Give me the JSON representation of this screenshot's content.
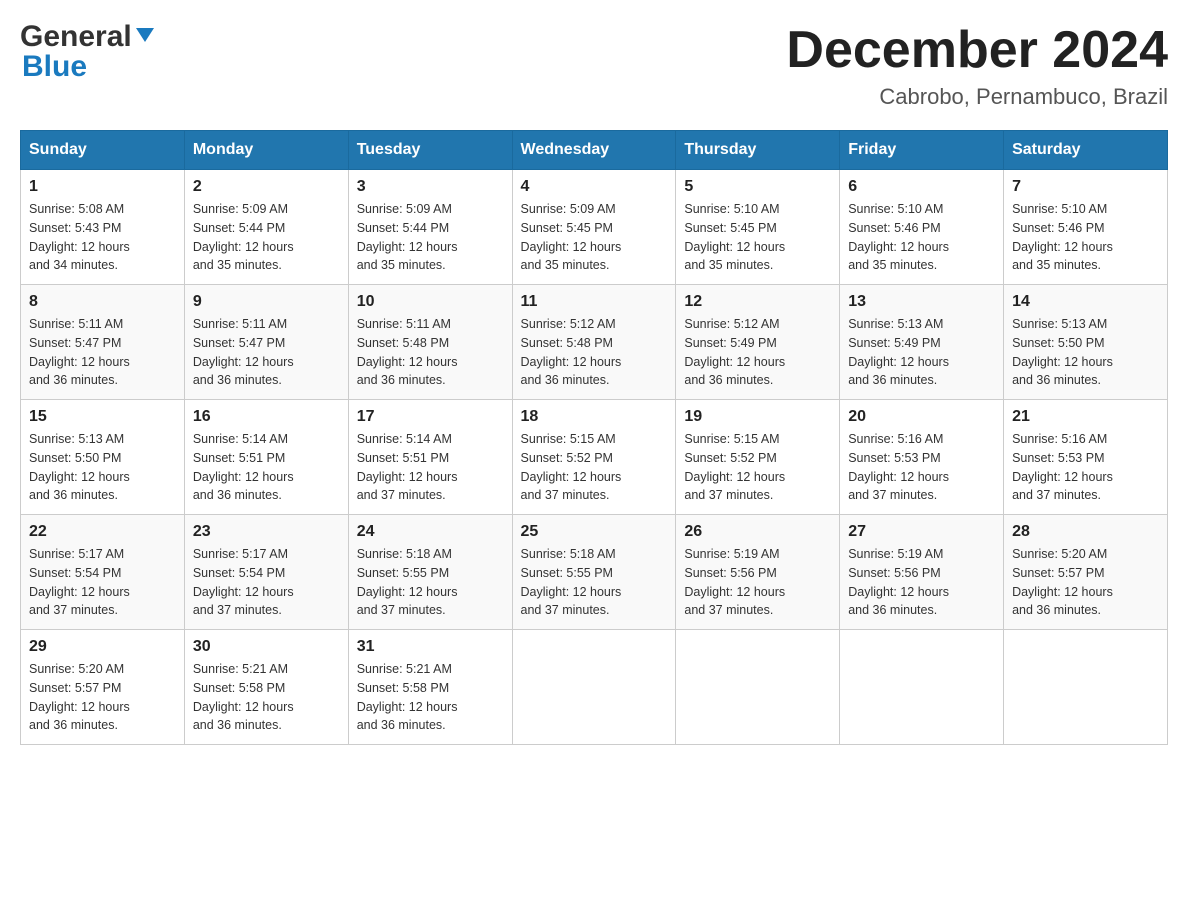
{
  "logo": {
    "general": "General",
    "blue": "Blue"
  },
  "header": {
    "month": "December 2024",
    "location": "Cabrobo, Pernambuco, Brazil"
  },
  "days_of_week": [
    "Sunday",
    "Monday",
    "Tuesday",
    "Wednesday",
    "Thursday",
    "Friday",
    "Saturday"
  ],
  "weeks": [
    [
      {
        "day": "1",
        "sunrise": "5:08 AM",
        "sunset": "5:43 PM",
        "daylight": "12 hours and 34 minutes."
      },
      {
        "day": "2",
        "sunrise": "5:09 AM",
        "sunset": "5:44 PM",
        "daylight": "12 hours and 35 minutes."
      },
      {
        "day": "3",
        "sunrise": "5:09 AM",
        "sunset": "5:44 PM",
        "daylight": "12 hours and 35 minutes."
      },
      {
        "day": "4",
        "sunrise": "5:09 AM",
        "sunset": "5:45 PM",
        "daylight": "12 hours and 35 minutes."
      },
      {
        "day": "5",
        "sunrise": "5:10 AM",
        "sunset": "5:45 PM",
        "daylight": "12 hours and 35 minutes."
      },
      {
        "day": "6",
        "sunrise": "5:10 AM",
        "sunset": "5:46 PM",
        "daylight": "12 hours and 35 minutes."
      },
      {
        "day": "7",
        "sunrise": "5:10 AM",
        "sunset": "5:46 PM",
        "daylight": "12 hours and 35 minutes."
      }
    ],
    [
      {
        "day": "8",
        "sunrise": "5:11 AM",
        "sunset": "5:47 PM",
        "daylight": "12 hours and 36 minutes."
      },
      {
        "day": "9",
        "sunrise": "5:11 AM",
        "sunset": "5:47 PM",
        "daylight": "12 hours and 36 minutes."
      },
      {
        "day": "10",
        "sunrise": "5:11 AM",
        "sunset": "5:48 PM",
        "daylight": "12 hours and 36 minutes."
      },
      {
        "day": "11",
        "sunrise": "5:12 AM",
        "sunset": "5:48 PM",
        "daylight": "12 hours and 36 minutes."
      },
      {
        "day": "12",
        "sunrise": "5:12 AM",
        "sunset": "5:49 PM",
        "daylight": "12 hours and 36 minutes."
      },
      {
        "day": "13",
        "sunrise": "5:13 AM",
        "sunset": "5:49 PM",
        "daylight": "12 hours and 36 minutes."
      },
      {
        "day": "14",
        "sunrise": "5:13 AM",
        "sunset": "5:50 PM",
        "daylight": "12 hours and 36 minutes."
      }
    ],
    [
      {
        "day": "15",
        "sunrise": "5:13 AM",
        "sunset": "5:50 PM",
        "daylight": "12 hours and 36 minutes."
      },
      {
        "day": "16",
        "sunrise": "5:14 AM",
        "sunset": "5:51 PM",
        "daylight": "12 hours and 36 minutes."
      },
      {
        "day": "17",
        "sunrise": "5:14 AM",
        "sunset": "5:51 PM",
        "daylight": "12 hours and 37 minutes."
      },
      {
        "day": "18",
        "sunrise": "5:15 AM",
        "sunset": "5:52 PM",
        "daylight": "12 hours and 37 minutes."
      },
      {
        "day": "19",
        "sunrise": "5:15 AM",
        "sunset": "5:52 PM",
        "daylight": "12 hours and 37 minutes."
      },
      {
        "day": "20",
        "sunrise": "5:16 AM",
        "sunset": "5:53 PM",
        "daylight": "12 hours and 37 minutes."
      },
      {
        "day": "21",
        "sunrise": "5:16 AM",
        "sunset": "5:53 PM",
        "daylight": "12 hours and 37 minutes."
      }
    ],
    [
      {
        "day": "22",
        "sunrise": "5:17 AM",
        "sunset": "5:54 PM",
        "daylight": "12 hours and 37 minutes."
      },
      {
        "day": "23",
        "sunrise": "5:17 AM",
        "sunset": "5:54 PM",
        "daylight": "12 hours and 37 minutes."
      },
      {
        "day": "24",
        "sunrise": "5:18 AM",
        "sunset": "5:55 PM",
        "daylight": "12 hours and 37 minutes."
      },
      {
        "day": "25",
        "sunrise": "5:18 AM",
        "sunset": "5:55 PM",
        "daylight": "12 hours and 37 minutes."
      },
      {
        "day": "26",
        "sunrise": "5:19 AM",
        "sunset": "5:56 PM",
        "daylight": "12 hours and 37 minutes."
      },
      {
        "day": "27",
        "sunrise": "5:19 AM",
        "sunset": "5:56 PM",
        "daylight": "12 hours and 36 minutes."
      },
      {
        "day": "28",
        "sunrise": "5:20 AM",
        "sunset": "5:57 PM",
        "daylight": "12 hours and 36 minutes."
      }
    ],
    [
      {
        "day": "29",
        "sunrise": "5:20 AM",
        "sunset": "5:57 PM",
        "daylight": "12 hours and 36 minutes."
      },
      {
        "day": "30",
        "sunrise": "5:21 AM",
        "sunset": "5:58 PM",
        "daylight": "12 hours and 36 minutes."
      },
      {
        "day": "31",
        "sunrise": "5:21 AM",
        "sunset": "5:58 PM",
        "daylight": "12 hours and 36 minutes."
      },
      null,
      null,
      null,
      null
    ]
  ],
  "labels": {
    "sunrise": "Sunrise:",
    "sunset": "Sunset:",
    "daylight": "Daylight:"
  }
}
